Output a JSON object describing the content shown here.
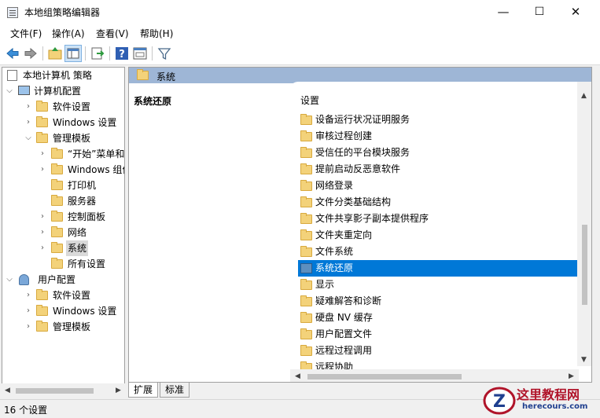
{
  "window": {
    "title": "本地组策略编辑器",
    "minimize_glyph": "—",
    "maximize_glyph": "☐",
    "close_glyph": "✕"
  },
  "menu": [
    "文件(F)",
    "操作(A)",
    "查看(V)",
    "帮助(H)"
  ],
  "toolbar": {
    "icons": [
      "back-arrow-icon",
      "forward-arrow-icon",
      "up-folder-icon",
      "show-tree-icon",
      "export-list-icon",
      "help-icon",
      "properties-icon",
      "filter-icon"
    ]
  },
  "tree": {
    "root": "本地计算机 策略",
    "computer_config": "计算机配置",
    "software_settings": "软件设置",
    "windows_settings": "Windows 设置",
    "admin_templates": "管理模板",
    "start_menu": "“开始”菜单和",
    "windows_components": "Windows 组件",
    "printers": "打印机",
    "servers": "服务器",
    "control_panel": "控制面板",
    "network": "网络",
    "system": "系统",
    "all_settings": "所有设置",
    "user_config": "用户配置",
    "user_software_settings": "软件设置",
    "user_windows_settings": "Windows 设置",
    "user_admin_templates": "管理模板"
  },
  "right": {
    "header": "系统",
    "desc_title": "系统还原",
    "column_header": "设置",
    "items": [
      "设备运行状况证明服务",
      "审核过程创建",
      "受信任的平台模块服务",
      "提前启动反恶意软件",
      "网络登录",
      "文件分类基础结构",
      "文件共享影子副本提供程序",
      "文件夹重定向",
      "文件系统",
      "系统还原",
      "显示",
      "疑难解答和诊断",
      "硬盘 NV 缓存",
      "用户配置文件",
      "远程过程调用",
      "远程协助"
    ],
    "selected_index": 9
  },
  "tabs": [
    "扩展",
    "标准"
  ],
  "status": "16 个设置",
  "watermark": {
    "line1": "这里教程网",
    "line2": "herecours.com",
    "logo_letter": "Z"
  },
  "colors": {
    "selection": "#0078d7",
    "header_band": "#9eb6d6",
    "folder": "#f3d27a"
  }
}
